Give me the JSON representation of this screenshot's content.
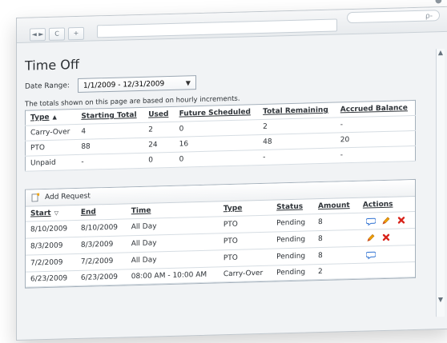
{
  "window": {
    "search_placeholder": "ρ-",
    "nav": {
      "back": "◄ ►",
      "refresh": "C",
      "new_tab": "+"
    }
  },
  "page": {
    "title": "Time Off",
    "date_range_label": "Date Range:",
    "date_range_value": "1/1/2009 - 12/31/2009",
    "totals_note": "The totals shown on this page are based on hourly increments."
  },
  "totals": {
    "headers": [
      "Type",
      "Starting Total",
      "Used",
      "Future Scheduled",
      "Total Remaining",
      "Accrued Balance"
    ],
    "rows": [
      [
        "Carry-Over",
        "4",
        "2",
        "0",
        "2",
        "-"
      ],
      [
        "PTO",
        "88",
        "24",
        "16",
        "48",
        "20"
      ],
      [
        "Unpaid",
        "-",
        "0",
        "0",
        "-",
        "-"
      ]
    ]
  },
  "requests": {
    "add_request_label": "Add Request",
    "headers": [
      "Start",
      "End",
      "Time",
      "Type",
      "Status",
      "Amount",
      "Actions"
    ],
    "rows": [
      {
        "start": "8/10/2009",
        "end": "8/10/2009",
        "time": "All Day",
        "type": "PTO",
        "status": "Pending",
        "amount": "8",
        "actions": [
          "comment",
          "edit",
          "delete"
        ]
      },
      {
        "start": "8/3/2009",
        "end": "8/3/2009",
        "time": "All Day",
        "type": "PTO",
        "status": "Pending",
        "amount": "8",
        "actions": [
          "edit",
          "delete"
        ]
      },
      {
        "start": "7/2/2009",
        "end": "7/2/2009",
        "time": "All Day",
        "type": "PTO",
        "status": "Pending",
        "amount": "8",
        "actions": [
          "comment"
        ]
      },
      {
        "start": "6/23/2009",
        "end": "6/23/2009",
        "time": "08:00 AM - 10:00 AM",
        "type": "Carry-Over",
        "status": "Pending",
        "amount": "2",
        "actions": []
      }
    ]
  },
  "icons": {
    "comment": "comment-icon",
    "edit": "edit-icon",
    "delete": "delete-icon",
    "sort": "sort-icon",
    "add": "add-request-icon"
  }
}
